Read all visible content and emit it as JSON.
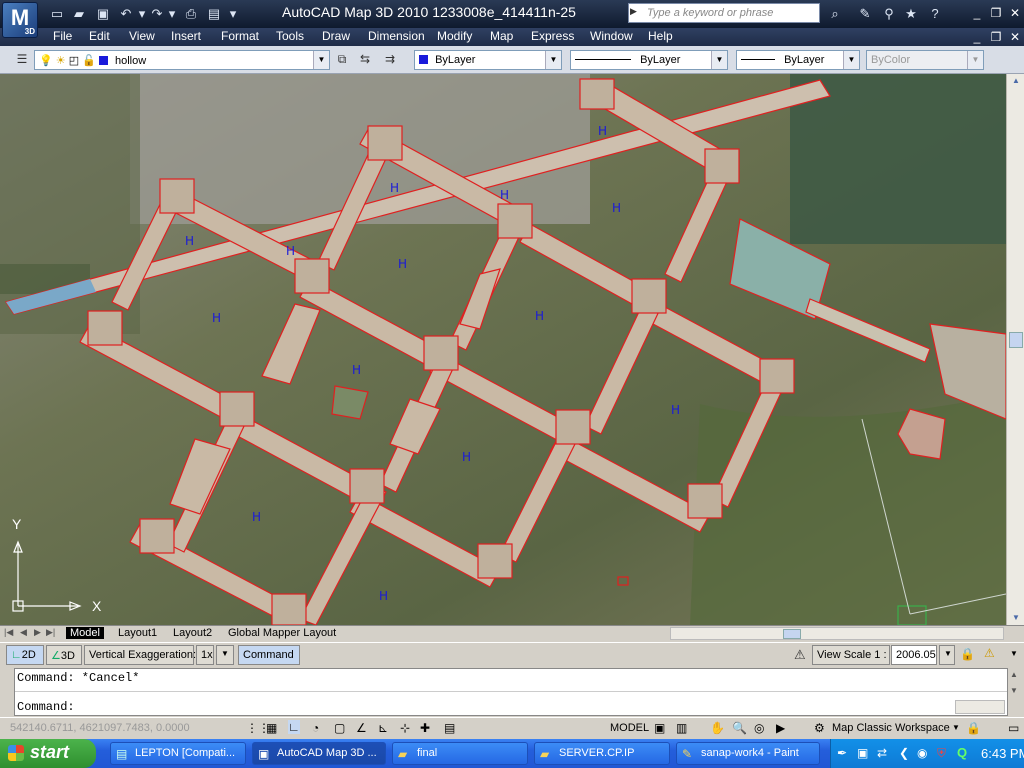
{
  "titlebar": {
    "logo_letter": "M",
    "logo_badge": "3D",
    "title": "AutoCAD Map 3D 2010    1233008e_414411n-25",
    "search_placeholder": "Type a keyword or phrase"
  },
  "menu": [
    "File",
    "Edit",
    "View",
    "Insert",
    "Format",
    "Tools",
    "Draw",
    "Dimension",
    "Modify",
    "Map",
    "Express",
    "Window",
    "Help"
  ],
  "layer_toolbar": {
    "layer_name": "hollow",
    "color": "ByLayer",
    "linetype": "ByLayer",
    "lineweight": "ByLayer",
    "plotstyle": "ByColor",
    "layer_color_hex": "#1a1adb"
  },
  "map": {
    "hatch_label": "H",
    "hatch_label_count": 17,
    "outline_color": "#e02020",
    "ucs_x": "X",
    "ucs_y": "Y"
  },
  "layout_tabs": [
    "Model",
    "Layout1",
    "Layout2",
    "Global Mapper Layout"
  ],
  "status_bar": {
    "btn_2d": "2D",
    "btn_3d": "3D",
    "vertical_exaggeration_label": "Vertical Exaggeration:",
    "vertical_exaggeration_value": "1x",
    "command_btn": "Command",
    "view_scale_label": "View Scale  1 :",
    "view_scale_value": "2006.05"
  },
  "command_line": {
    "line1": "Command: *Cancel*",
    "line2": "Command:"
  },
  "bottom_status": {
    "coordinates": "542140.6711, 4621097.7483, 0.0000",
    "model_label": "MODEL",
    "workspace": "Map Classic Workspace"
  },
  "taskbar": {
    "start": "start",
    "tasks": [
      "LEPTON [Compati...",
      "AutoCAD Map 3D ...",
      "final",
      "SERVER.CP.IP",
      "sanap-work4 - Paint"
    ],
    "clock": "6:43 PM"
  }
}
